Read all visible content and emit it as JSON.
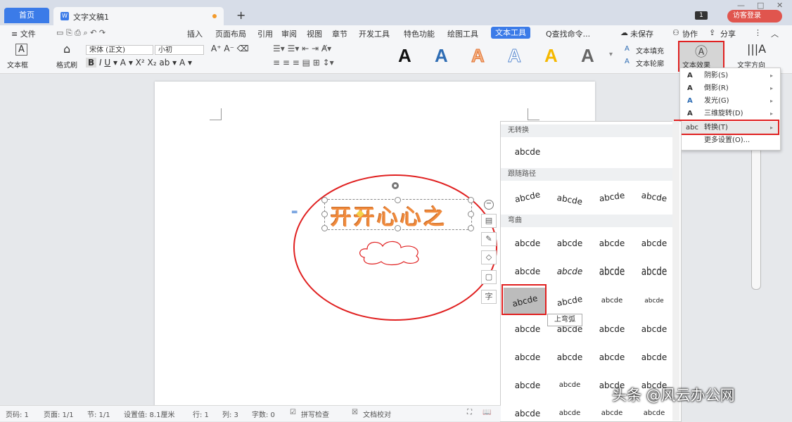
{
  "titlebar": {
    "home_tab": "首页",
    "doc_tab": "文字文稿1",
    "new_tab": "+",
    "page_count": "1",
    "visitor_login": "访客登录",
    "win_min": "—",
    "win_max": "□",
    "win_close": "✕"
  },
  "menubar": {
    "file": "≡ 文件",
    "items": [
      "插入",
      "页面布局",
      "引用",
      "审阅",
      "视图",
      "章节",
      "开发工具",
      "特色功能",
      "绘图工具",
      "文本工具"
    ],
    "active": "文本工具",
    "search": "Q查找命令...",
    "unsaved": "未保存",
    "collab": "协作",
    "share": "分享"
  },
  "ribbon": {
    "textbox": "文本框",
    "format_painter": "格式刷",
    "font_name": "宋体 (正文)",
    "font_size": "小初",
    "text_fill": "文本填充",
    "text_outline": "文本轮廓",
    "text_effect": "文本效果",
    "text_direction": "文字方向"
  },
  "document": {
    "wordart": "开开心心之"
  },
  "effects_menu": {
    "items": [
      {
        "icon": "A",
        "label": "阴影(S)",
        "arrow": "▸"
      },
      {
        "icon": "A",
        "label": "倒影(R)",
        "arrow": "▸"
      },
      {
        "icon": "A",
        "label": "发光(G)",
        "arrow": "▸"
      },
      {
        "icon": "A",
        "label": "三维旋转(D)",
        "arrow": "▸"
      },
      {
        "icon": "abc",
        "label": "转换(T)",
        "arrow": "▸"
      },
      {
        "icon": "",
        "label": "更多设置(O)...",
        "arrow": ""
      }
    ]
  },
  "gallery": {
    "no_transform": "无转换",
    "follow_path": "跟随路径",
    "warp": "弯曲",
    "sample": "abcde",
    "tooltip": "上弯弧"
  },
  "statusbar": {
    "page_no": "页码: 1",
    "pages": "页面: 1/1",
    "section": "节: 1/1",
    "setting": "设置值: 8.1厘米",
    "row": "行: 1",
    "col": "列: 3",
    "words": "字数: 0",
    "spell": "拼写检查",
    "proof": "文档校对"
  },
  "watermark": "头条 @风云办公网"
}
